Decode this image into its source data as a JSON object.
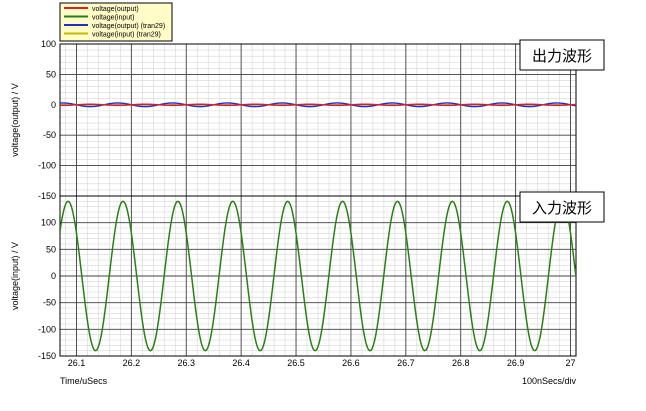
{
  "chart_data": [
    {
      "type": "line",
      "panel": "top",
      "annotation": "出力波形",
      "ylabel": "voltage(output) / V",
      "ylim": [
        -150,
        100
      ],
      "yticks": [
        -150,
        -100,
        -50,
        0,
        50,
        100
      ],
      "xlim": [
        26.07,
        27.01
      ],
      "xticks": [
        26.1,
        26.2,
        26.3,
        26.4,
        26.5,
        26.6,
        26.7,
        26.8,
        26.9,
        27
      ],
      "grid": true,
      "series": [
        {
          "name": "voltage(output)",
          "color": "#e02020",
          "waveform": {
            "amplitude": 1,
            "period_us": 0.1,
            "phase_deg": 0,
            "offset": 0
          }
        },
        {
          "name": "voltage(output) (tran29)",
          "color": "#2030c0",
          "waveform": {
            "amplitude": 3,
            "period_us": 0.1,
            "phase_deg": 180,
            "offset": 0
          }
        }
      ]
    },
    {
      "type": "line",
      "panel": "bottom",
      "annotation": "入力波形",
      "ylabel": "voltage(input) / V",
      "ylim": [
        -150,
        150
      ],
      "yticks": [
        -150,
        -100,
        -50,
        0,
        50,
        100
      ],
      "xlim": [
        26.07,
        27.01
      ],
      "xticks": [
        26.1,
        26.2,
        26.3,
        26.4,
        26.5,
        26.6,
        26.7,
        26.8,
        26.9,
        27
      ],
      "xtick_labels": [
        "26.1",
        "26.2",
        "26.3",
        "26.4",
        "26.5",
        "26.6",
        "26.7",
        "26.8",
        "26.9",
        "27"
      ],
      "grid": true,
      "series": [
        {
          "name": "voltage(input)",
          "color": "#208020",
          "waveform": {
            "amplitude": 140,
            "period_us": 0.1,
            "phase_deg": 145,
            "offset": 0
          }
        },
        {
          "name": "voltage(input) (tran29)",
          "color": "#c8b400",
          "waveform": {
            "amplitude": 140,
            "period_us": 0.1,
            "phase_deg": 145,
            "offset": 0
          }
        }
      ]
    }
  ],
  "legend": {
    "placement": "top-left",
    "entries": [
      {
        "label": "voltage(output)",
        "color": "#e02020"
      },
      {
        "label": "voltage(input)",
        "color": "#208020"
      },
      {
        "label": "voltage(output) (tran29)",
        "color": "#2030c0"
      },
      {
        "label": "voltage(input) (tran29)",
        "color": "#c8b400"
      }
    ],
    "background": "#fffcc8"
  },
  "x_axis_label": "Time/uSecs",
  "x_scale_label": "100nSecs/div"
}
